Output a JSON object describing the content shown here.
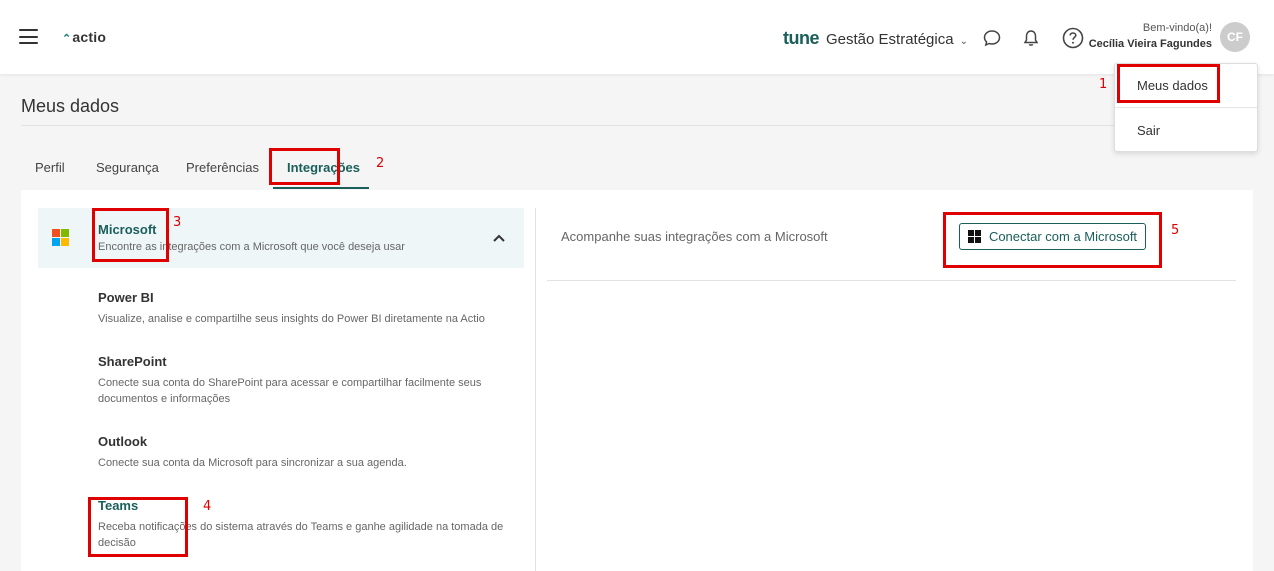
{
  "header": {
    "logo": "actio",
    "brand_prefix": "tune",
    "brand_module": "Gestão Estratégica",
    "welcome": "Bem-vindo(a)!",
    "user_name": "Cecília Vieira Fagundes",
    "avatar_initials": "CF",
    "icons": [
      "menu-icon",
      "chat-icon",
      "bell-icon",
      "help-icon"
    ]
  },
  "dropdown": {
    "items": [
      {
        "label": "Meus dados"
      },
      {
        "label": "Sair"
      }
    ]
  },
  "page": {
    "title": "Meus dados"
  },
  "tabs": [
    {
      "label": "Perfil"
    },
    {
      "label": "Segurança"
    },
    {
      "label": "Preferências"
    },
    {
      "label": "Integrações",
      "active": true
    }
  ],
  "integrations": {
    "provider": {
      "title": "Microsoft",
      "description": "Encontre as integrações com a Microsoft que você deseja usar"
    },
    "items": [
      {
        "title": "Power BI",
        "description": "Visualize, analise e compartilhe seus insights do Power BI diretamente na Actio"
      },
      {
        "title": "SharePoint",
        "description": "Conecte sua conta do SharePoint para acessar e compartilhar facilmente seus documentos e informações"
      },
      {
        "title": "Outlook",
        "description": "Conecte sua conta da Microsoft para sincronizar a sua agenda."
      },
      {
        "title": "Teams",
        "description": "Receba notificações do sistema através do Teams e ganhe agilidade na tomada de decisão"
      }
    ]
  },
  "right_panel": {
    "text": "Acompanhe suas integrações com a Microsoft",
    "connect_label": "Conectar com a Microsoft"
  },
  "annotations": [
    "1",
    "2",
    "3",
    "4",
    "5"
  ],
  "colors": {
    "accent": "#1a5f5a",
    "annotation": "#e00000",
    "ms_red": "#f25022",
    "ms_green": "#7fba00",
    "ms_blue": "#00a4ef",
    "ms_yellow": "#ffb900"
  }
}
